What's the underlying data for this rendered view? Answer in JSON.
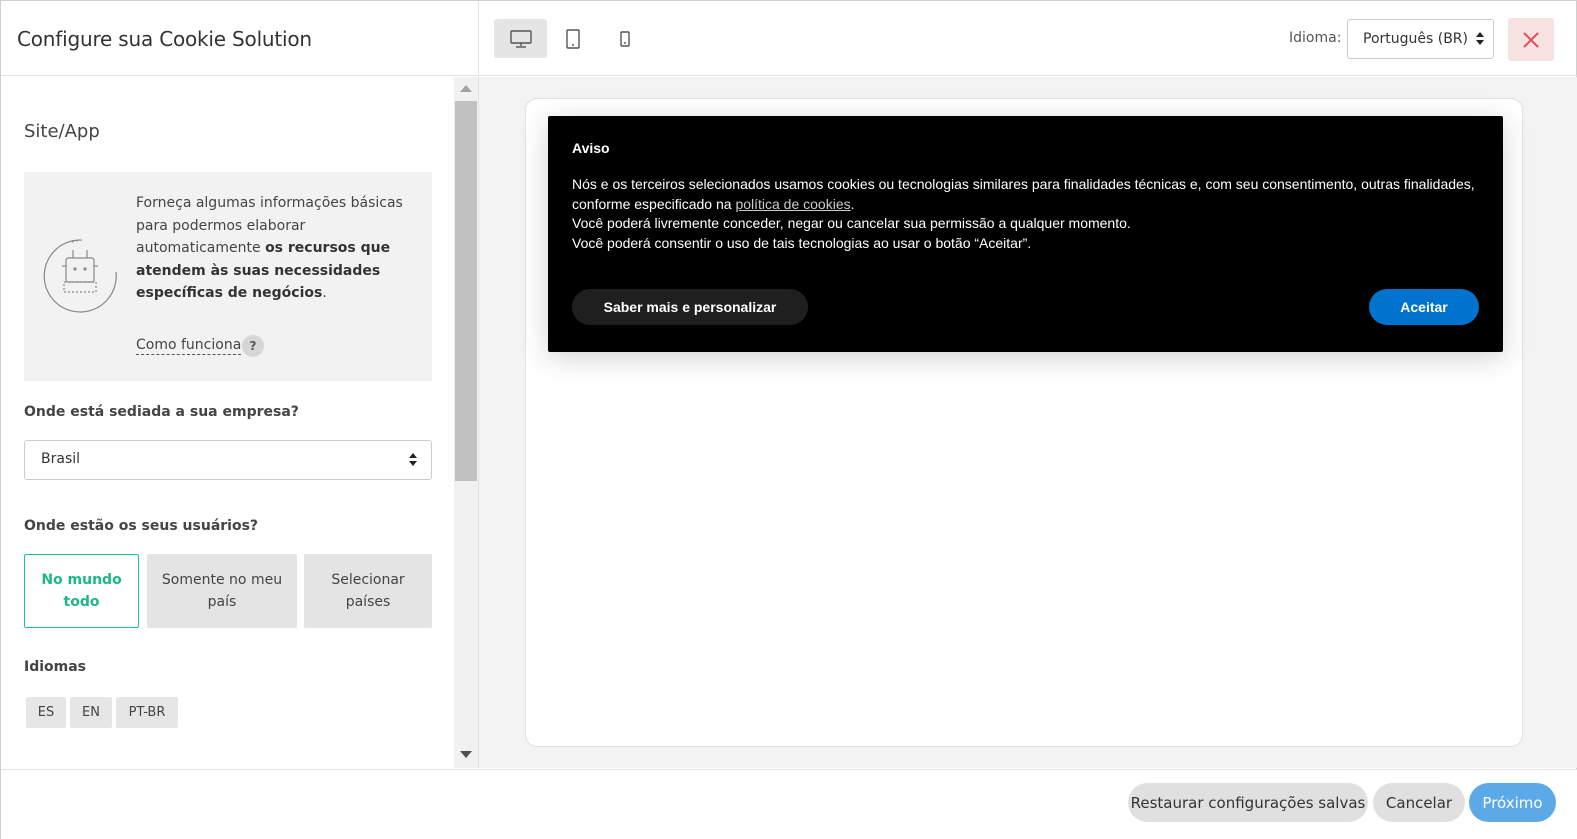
{
  "header": {
    "title": "Configure sua Cookie Solution"
  },
  "sidebar": {
    "section_title": "Site/App",
    "info": {
      "text_intro": "Forneça algumas informações básicas para podermos elaborar automaticamente ",
      "text_bold": "os recursos que atendem às suas necessidades específicas de negócios",
      "text_end": ".",
      "how_link": "Como funciona",
      "help": "?"
    },
    "company_question": "Onde está sediada a sua empresa?",
    "company_value": "Brasil",
    "users_question": "Onde estão os seus usuários?",
    "user_options": [
      "No mundo todo",
      "Somente no meu país",
      "Selecionar países"
    ],
    "languages_label": "Idiomas",
    "languages": [
      "ES",
      "EN",
      "PT-BR"
    ]
  },
  "topbar": {
    "language_label": "Idioma:",
    "language_value": "Português (BR)",
    "devices": [
      "desktop-icon",
      "tablet-icon",
      "mobile-icon"
    ],
    "close": "close-icon"
  },
  "banner": {
    "title": "Aviso",
    "line1": "Nós e os terceiros selecionados usamos cookies ou tecnologias similares para finalidades técnicas e, com seu consentimento, outras finalidades, conforme especificado na ",
    "policy_link": "política de cookies",
    "line1_end": ".",
    "line2": "Você poderá livremente conceder, negar ou cancelar sua permissão a qualquer momento.",
    "line3": "Você poderá consentir o uso de tais tecnologias ao usar o botão “Aceitar”.",
    "more_button": "Saber mais e personalizar",
    "accept_button": "Aceitar"
  },
  "footer": {
    "restore": "Restaurar configurações salvas",
    "cancel": "Cancelar",
    "next": "Próximo"
  },
  "colors": {
    "accent_green": "#1cc691",
    "accept_blue": "#0073ce",
    "next_blue": "#5ba9e6",
    "close_red": "#e0525b"
  }
}
